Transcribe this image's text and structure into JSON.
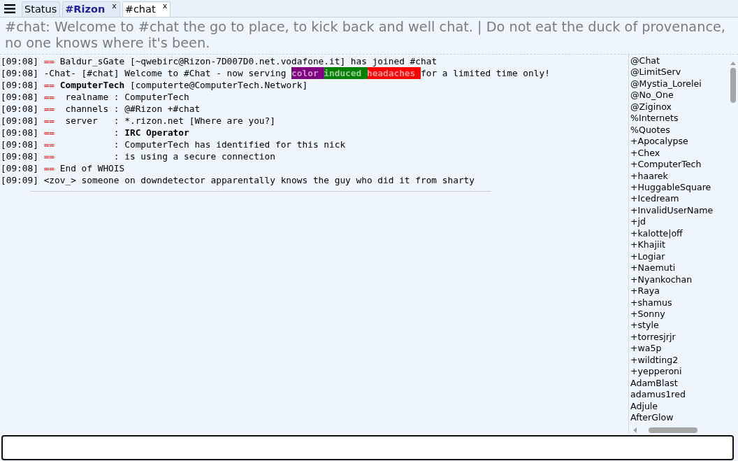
{
  "tabs": [
    {
      "label": "Status",
      "selected": false,
      "highlighted": false
    },
    {
      "label": "#Rizon",
      "selected": false,
      "highlighted": true,
      "close": "x"
    },
    {
      "label": "#chat",
      "selected": true,
      "highlighted": false,
      "close": "x"
    }
  ],
  "topic": "#chat: Welcome to #chat the go to place, to kick back and well chat. | Do not eat the duck of provenance, no one knows where it's been.",
  "messages": [
    {
      "time": "[09:08]",
      "segments": [
        {
          "kind": "marker",
          "text": "=="
        },
        {
          "kind": "plain",
          "text": " Baldur_sGate [~qwebirc@Rizon-7D007D0.net.vodafone.it] has joined #chat"
        }
      ]
    },
    {
      "time": "[09:08]",
      "segments": [
        {
          "kind": "plain",
          "text": "-Chat- [#chat] Welcome to #Chat - now serving "
        },
        {
          "kind": "colored",
          "color": "#7f007f",
          "text": "color "
        },
        {
          "kind": "colored",
          "color": "#008000",
          "text": "induced "
        },
        {
          "kind": "colored",
          "color": "#ff0000",
          "text": "headaches "
        },
        {
          "kind": "plain",
          "text": "for a limited time only!"
        }
      ]
    },
    {
      "time": "[09:08]",
      "segments": [
        {
          "kind": "marker",
          "text": "=="
        },
        {
          "kind": "plain",
          "text": " **ComputerTech** [computerte@ComputerTech.Network]"
        }
      ]
    },
    {
      "time": "[09:08]",
      "segments": [
        {
          "kind": "marker",
          "text": "=="
        },
        {
          "kind": "plain",
          "text": "  realname : ComputerTech"
        }
      ]
    },
    {
      "time": "[09:08]",
      "segments": [
        {
          "kind": "marker",
          "text": "=="
        },
        {
          "kind": "plain",
          "text": "  channels : @#Rizon +#chat"
        }
      ]
    },
    {
      "time": "[09:08]",
      "segments": [
        {
          "kind": "marker",
          "text": "=="
        },
        {
          "kind": "plain",
          "text": "  server   : *.rizon.net [Where are you?]"
        }
      ]
    },
    {
      "time": "[09:08]",
      "segments": [
        {
          "kind": "marker",
          "text": "=="
        },
        {
          "kind": "plain",
          "text": "           : **IRC Operator**"
        }
      ]
    },
    {
      "time": "[09:08]",
      "segments": [
        {
          "kind": "marker",
          "text": "=="
        },
        {
          "kind": "plain",
          "text": "           : ComputerTech has identified for this nick"
        }
      ]
    },
    {
      "time": "[09:08]",
      "segments": [
        {
          "kind": "marker",
          "text": "=="
        },
        {
          "kind": "plain",
          "text": "           : is using a secure connection"
        }
      ]
    },
    {
      "time": "[09:08]",
      "segments": [
        {
          "kind": "marker",
          "text": "=="
        },
        {
          "kind": "plain",
          "text": " End of WHOIS"
        }
      ]
    },
    {
      "time": "[09:09]",
      "segments": [
        {
          "kind": "plain",
          "text": "<zov_> someone on downdetector apparentally knows the guy who did it from sharty"
        }
      ]
    }
  ],
  "read_marker": true,
  "nicklist": [
    "@Chat",
    "@LimitServ",
    "@Mystia_Lorelei",
    "@No_One",
    "@Ziginox",
    "%Internets",
    "%Quotes",
    "+Apocalypse",
    "+Chex",
    "+ComputerTech",
    "+haarek",
    "+HuggableSquare",
    "+Icedream",
    "+InvalidUserName",
    "+jd",
    "+kalotte|off",
    "+Khajiit",
    "+Logiar",
    "+Naemuti",
    "+Nyankochan",
    "+Raya",
    "+shamus",
    "+Sonny",
    "+style",
    "+torresjrjr",
    "+wa5p",
    "+wildting2",
    "+yepperoni",
    "AdamBlast",
    "adamus1red",
    "Adjule",
    "AfterGlow"
  ]
}
